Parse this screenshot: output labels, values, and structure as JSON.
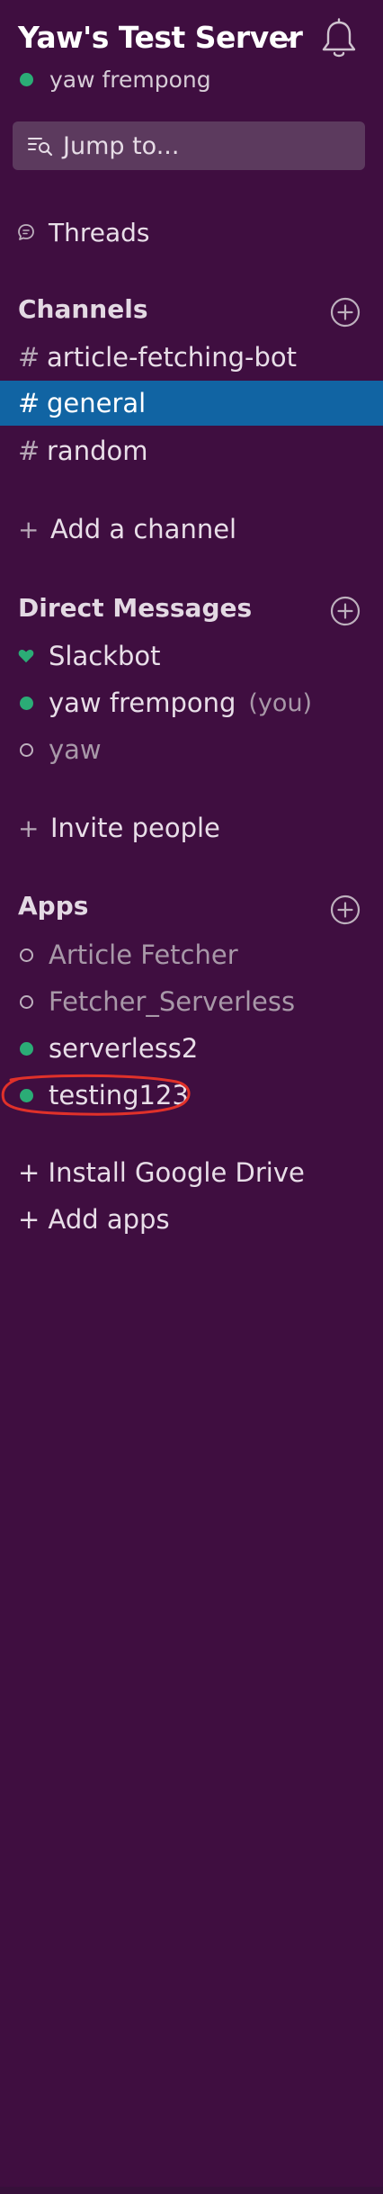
{
  "header": {
    "team_name": "Yaw's Test Server",
    "user_name": "yaw frempong"
  },
  "jump": {
    "label": "Jump to..."
  },
  "threads": {
    "label": "Threads"
  },
  "channels": {
    "title": "Channels",
    "items": [
      {
        "label": "article-fetching-bot"
      },
      {
        "label": "general"
      },
      {
        "label": "random"
      }
    ],
    "add_label": "Add a channel"
  },
  "direct_messages": {
    "title": "Direct Messages",
    "items": [
      {
        "label": "Slackbot"
      },
      {
        "label": "yaw frempong",
        "tag": "(you)"
      },
      {
        "label": "yaw"
      }
    ],
    "invite_label": "Invite people"
  },
  "apps": {
    "title": "Apps",
    "items": [
      {
        "label": "Article Fetcher"
      },
      {
        "label": "Fetcher_Serverless"
      },
      {
        "label": "serverless2"
      },
      {
        "label": "testing123"
      }
    ],
    "install_label": "+ Install Google Drive",
    "add_apps_label": "+ Add apps"
  },
  "colors": {
    "sidebar_bg": "#3F0E40",
    "selected_bg": "#1164A3",
    "presence_online": "#2BAC76",
    "annotation_red": "#E0312A"
  }
}
